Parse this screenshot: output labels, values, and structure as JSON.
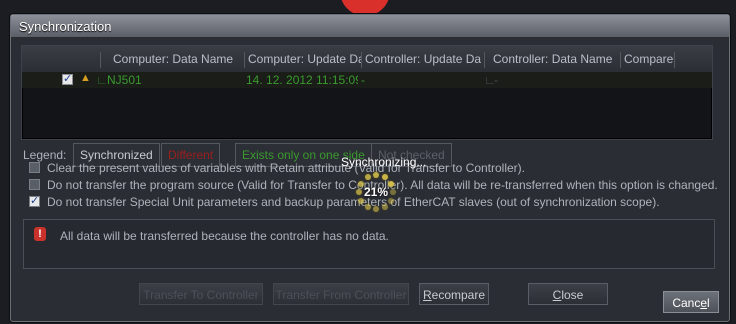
{
  "window": {
    "title": "Synchronization"
  },
  "grid": {
    "columns": [
      "Computer: Data Name",
      "Computer: Update Da",
      "Controller: Update Da",
      "Controller: Data Name",
      "Compare"
    ],
    "rows": [
      {
        "checked": true,
        "computer_data_name": "NJ501",
        "computer_update_date": "14. 12. 2012 11:15:09",
        "controller_update_date": "-",
        "controller_data_name": "-",
        "compare": ""
      }
    ]
  },
  "legend": {
    "label": "Legend:",
    "items": [
      {
        "label": "Synchronized",
        "color": "#c8ccd2"
      },
      {
        "label": "Different",
        "color": "#9b1f1f"
      },
      {
        "label": "Exists only on one side",
        "color": "#3a9a2e"
      },
      {
        "label": "Not checked",
        "color": "#5c6068"
      }
    ]
  },
  "options": [
    {
      "checked": false,
      "label": "Clear the present values of variables with Retain attribute (Valid for Transfer to Controller)."
    },
    {
      "checked": false,
      "label": "Do not transfer the program source (Valid for Transfer to Controller). All data will be re-transferred when this option is changed."
    },
    {
      "checked": true,
      "label": "Do not transfer Special Unit parameters and backup parameters of EtherCAT slaves (out of synchronization scope)."
    }
  ],
  "message": {
    "text": "All data will be transferred because the controller has no data."
  },
  "progress": {
    "status": "Synchronizing...",
    "percent_label": "21%",
    "percent": 21
  },
  "buttons": {
    "transfer_to": "Transfer To Controller",
    "transfer_from": "Transfer From Controller",
    "recompare_prefix": "R",
    "recompare_rest": "ecompare",
    "close_prefix": "C",
    "close_rest": "lose",
    "cancel_main": "Canc",
    "cancel_u": "e",
    "cancel_end": "l"
  },
  "colors": {
    "accent_green": "#3a9a2e",
    "warning_red": "#c9312b",
    "spinner_yellow": "#d8c24a"
  }
}
